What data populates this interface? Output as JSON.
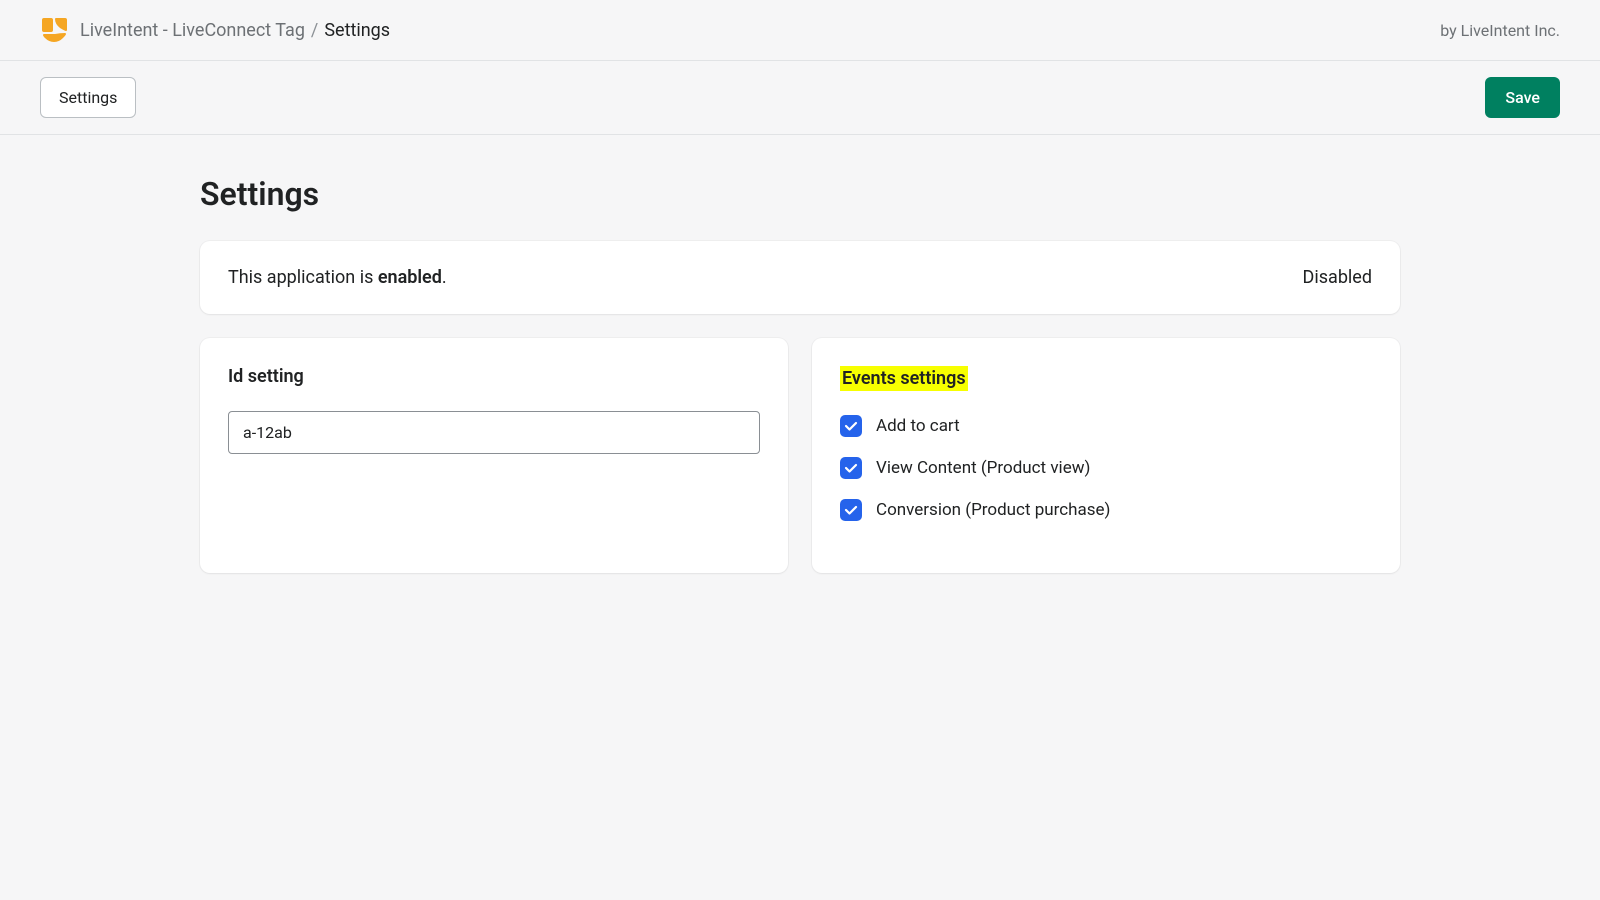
{
  "header": {
    "breadcrumb_parent": "LiveIntent - LiveConnect Tag",
    "breadcrumb_separator": "/",
    "breadcrumb_current": "Settings",
    "by_line": "by LiveIntent Inc."
  },
  "toolbar": {
    "settings_label": "Settings",
    "save_label": "Save"
  },
  "page": {
    "title": "Settings"
  },
  "status": {
    "prefix": "This application is ",
    "state": "enabled",
    "suffix": ".",
    "toggle_label": "Disabled"
  },
  "id_setting": {
    "title": "Id setting",
    "value": "a-12ab"
  },
  "events_settings": {
    "title": "Events settings",
    "items": [
      {
        "label": "Add to cart",
        "checked": true
      },
      {
        "label": "View Content (Product view)",
        "checked": true
      },
      {
        "label": "Conversion (Product purchase)",
        "checked": true
      }
    ]
  }
}
